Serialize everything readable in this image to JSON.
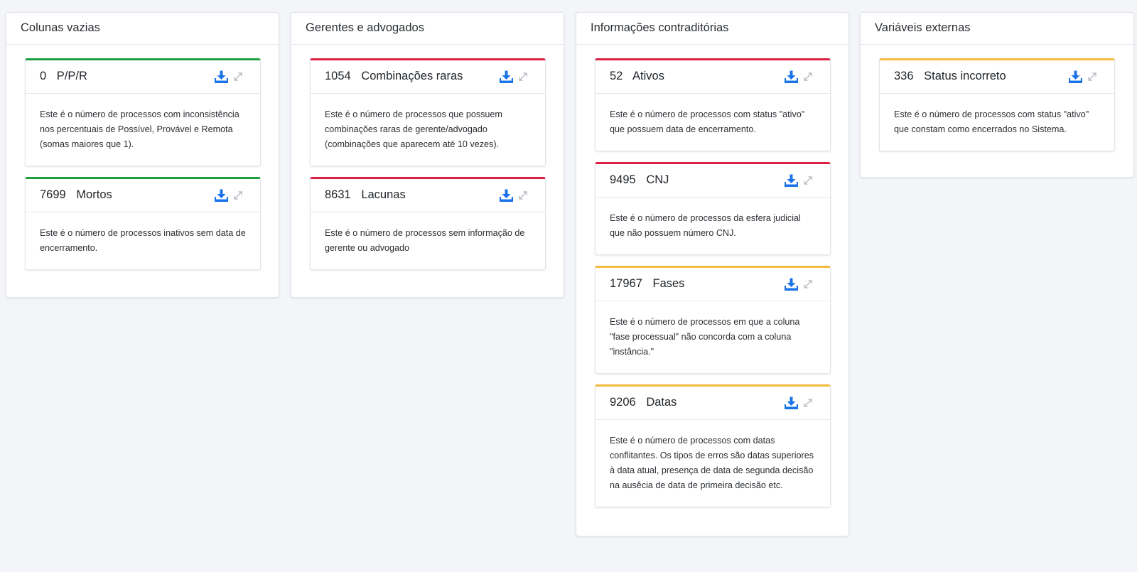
{
  "colors": {
    "green": "#1e9e3e",
    "red": "#dc2144",
    "yellow": "#f5bb3c",
    "download_icon": "#1a73e8",
    "expand_icon": "#b8bcc2"
  },
  "icons": {
    "download": "download-icon",
    "expand": "expand-icon"
  },
  "columns": [
    {
      "title": "Colunas vazias",
      "cards": [
        {
          "count": "0",
          "title": "P/P/R",
          "status": "green",
          "text": "Este é o número de processos com inconsistência nos percentuais de Possível, Provável e Remota (somas maiores que 1)."
        },
        {
          "count": "7699",
          "title": "Mortos",
          "status": "green",
          "text": "Este é o número de processos inativos sem data de encerramento."
        }
      ]
    },
    {
      "title": "Gerentes e advogados",
      "cards": [
        {
          "count": "1054",
          "title": "Combinações raras",
          "status": "red",
          "text": "Este é o número de processos que possuem combinações raras de gerente/advogado (combinações que aparecem até 10 vezes)."
        },
        {
          "count": "8631",
          "title": "Lacunas",
          "status": "red",
          "text": "Este é o número de processos sem informação de gerente ou advogado"
        }
      ]
    },
    {
      "title": "Informações contraditórias",
      "cards": [
        {
          "count": "52",
          "title": "Ativos",
          "status": "red",
          "text": "Este é o número de processos com status \"ativo\" que possuem data de encerramento."
        },
        {
          "count": "9495",
          "title": "CNJ",
          "status": "red",
          "text": "Este é o número de processos da esfera judicial que não possuem número CNJ."
        },
        {
          "count": "17967",
          "title": "Fases",
          "status": "yellow",
          "text": "Este é o número de processos em que a coluna \"fase processual\" não concorda com a coluna \"instância.\""
        },
        {
          "count": "9206",
          "title": "Datas",
          "status": "yellow",
          "text": "Este é o número de processos com datas conflitantes. Os tipos de erros são datas superiores à data atual, presença de data de segunda decisão na ausêcia de data de primeira decisão etc."
        }
      ]
    },
    {
      "title": "Variáveis externas",
      "cards": [
        {
          "count": "336",
          "title": "Status incorreto",
          "status": "yellow",
          "text": "Este é o número de processos com status \"ativo\" que constam como encerrados no Sistema."
        }
      ]
    }
  ]
}
